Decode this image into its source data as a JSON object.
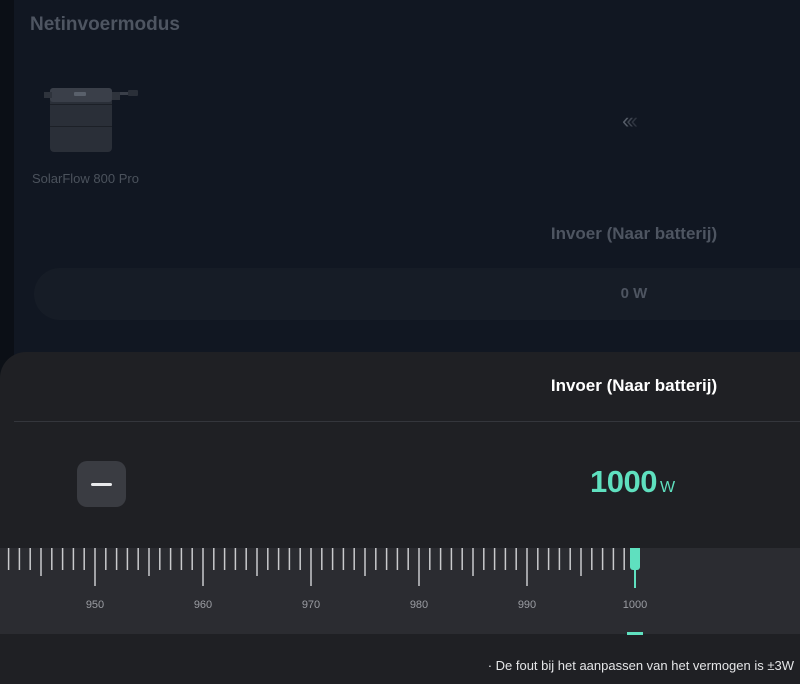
{
  "background": {
    "section_title": "Netinvoermodus",
    "device": {
      "label": "SolarFlow 800 Pro",
      "icon": "battery-device-icon"
    },
    "flow_arrows": "<<<",
    "input_title": "Invoer (Naar batterij)",
    "input_value": "0 W"
  },
  "sheet": {
    "title": "Invoer (Naar batterij)",
    "minus_icon": "minus-icon",
    "value": "1000",
    "unit": "W",
    "ruler": {
      "labels": [
        "950",
        "960",
        "970",
        "980",
        "990",
        "1000"
      ],
      "min": 950,
      "max": 1000,
      "current": 1000
    },
    "footnote": "· De fout bij het aanpassen van het vermogen is ±3W"
  },
  "colors": {
    "accent": "#5fe0bf",
    "sheet_bg": "#1f2024",
    "page_bg": "#111722"
  }
}
